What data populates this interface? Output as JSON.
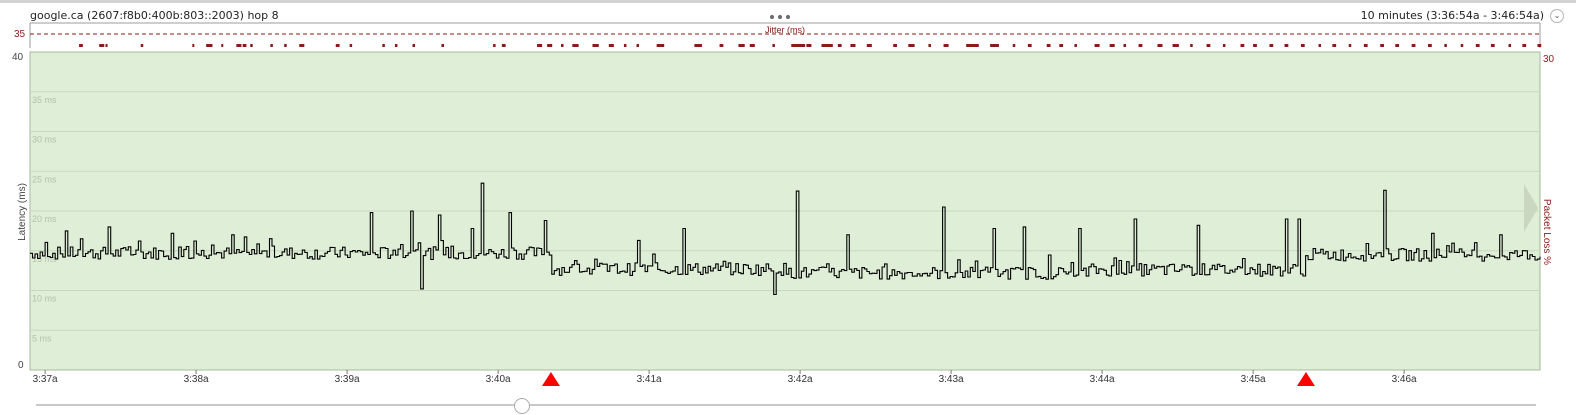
{
  "header": {
    "title": "google.ca (2607:f8b0:400b:803::2003) hop 8",
    "time_range": "10 minutes (3:36:54a - 3:46:54a)"
  },
  "colors": {
    "plot_bg": "#dfeed6",
    "jitter": "#8b1a1a",
    "loss_marker": "#ff0000",
    "latency_line": "#000000",
    "axis_text": "#555555"
  },
  "chart_data": [
    {
      "type": "bar",
      "title": "Jitter (ms)",
      "ymax_label": "35",
      "threshold_line": "dashed",
      "bar_intervals_min": [
        [
          3.9,
          4.2
        ],
        [
          5.5,
          5.9
        ],
        [
          6.0,
          6.15
        ],
        [
          8.8,
          9.0
        ],
        [
          12.9,
          13.05
        ],
        [
          14.0,
          14.5
        ],
        [
          15.2,
          15.3
        ],
        [
          16.4,
          16.8
        ],
        [
          16.9,
          17.2
        ],
        [
          17.5,
          17.7
        ],
        [
          19.1,
          19.3
        ],
        [
          20.2,
          20.4
        ],
        [
          21.4,
          21.8
        ],
        [
          24.3,
          24.6
        ],
        [
          25.4,
          25.6
        ],
        [
          28.0,
          28.2
        ],
        [
          29.0,
          29.2
        ],
        [
          30.4,
          30.6
        ],
        [
          32.7,
          32.9
        ],
        [
          36.8,
          37.0
        ],
        [
          37.5,
          37.8
        ],
        [
          40.3,
          40.7
        ],
        [
          41.1,
          41.5
        ],
        [
          42.2,
          42.4
        ],
        [
          43.1,
          43.6
        ],
        [
          44.7,
          45.2
        ],
        [
          46.0,
          46.4
        ],
        [
          47.2,
          47.4
        ],
        [
          48.2,
          48.4
        ],
        [
          49.8,
          50.4
        ],
        [
          52.8,
          53.4
        ],
        [
          54.8,
          55.1
        ],
        [
          56.3,
          56.8
        ],
        [
          57.2,
          57.6
        ],
        [
          59.0,
          59.2
        ],
        [
          60.5,
          61.6
        ],
        [
          61.7,
          62.1
        ],
        [
          62.9,
          63.8
        ],
        [
          64.2,
          64.5
        ],
        [
          65.2,
          65.6
        ],
        [
          66.5,
          66.9
        ],
        [
          68.6,
          68.9
        ],
        [
          69.8,
          70.3
        ],
        [
          71.4,
          71.6
        ],
        [
          72.6,
          73.0
        ],
        [
          74.4,
          75.4
        ],
        [
          76.3,
          77.0
        ],
        [
          78.1,
          78.3
        ],
        [
          79.3,
          79.6
        ],
        [
          80.8,
          81.1
        ],
        [
          81.8,
          82.1
        ],
        [
          83.0,
          83.2
        ],
        [
          84.6,
          85.0
        ],
        [
          85.8,
          86.2
        ],
        [
          86.9,
          87.1
        ],
        [
          88.1,
          88.4
        ],
        [
          89.6,
          90.0
        ],
        [
          90.8,
          91.3
        ],
        [
          92.2,
          92.4
        ],
        [
          93.5,
          93.8
        ],
        [
          94.8,
          95.0
        ],
        [
          96.2,
          96.5
        ],
        [
          97.2,
          97.5
        ],
        [
          98.5,
          98.8
        ],
        [
          99.7,
          100.0
        ],
        [
          101.0,
          101.3
        ],
        [
          102.4,
          102.6
        ],
        [
          103.5,
          103.8
        ],
        [
          104.8,
          105.0
        ],
        [
          106.0,
          106.3
        ],
        [
          107.3,
          107.6
        ],
        [
          108.5,
          108.8
        ],
        [
          109.8,
          110.1
        ],
        [
          111.1,
          111.4
        ],
        [
          112.4,
          112.6
        ],
        [
          113.7,
          113.9
        ],
        [
          114.9,
          115.2
        ],
        [
          116.1,
          116.4
        ],
        [
          117.5,
          117.7
        ],
        [
          118.6,
          118.9
        ],
        [
          119.8,
          120.1
        ]
      ]
    },
    {
      "type": "line",
      "xlabel": "",
      "ylabel": "Latency (ms)",
      "ylabel_right": "Packet Loss %",
      "ylim": [
        0,
        40
      ],
      "ylim_right_max": 30,
      "ytick_labels": [
        "40",
        "0"
      ],
      "ytick_right_labels": [
        "30"
      ],
      "gridline_labels": [
        "35 ms",
        "30 ms",
        "25 ms",
        "20 ms",
        "15 ms",
        "10 ms",
        "5 ms"
      ],
      "gridline_values": [
        35,
        30,
        25,
        20,
        15,
        10,
        5
      ],
      "x_tick_labels": [
        "3:37a",
        "3:38a",
        "3:39a",
        "3:40a",
        "3:41a",
        "3:42a",
        "3:43a",
        "3:44a",
        "3:45a",
        "3:46a"
      ],
      "x_tick_offsets_min": [
        0.1,
        1.1,
        2.1,
        3.1,
        4.1,
        5.1,
        6.1,
        7.1,
        8.1,
        9.1
      ],
      "x_range_min": [
        0,
        10
      ],
      "packet_loss_events_min": [
        3.45,
        8.45
      ],
      "grid": true,
      "series": [
        {
          "baseline_segments": [
            {
              "from_min": 0.0,
              "to_min": 3.45,
              "ms": 14.7
            },
            {
              "from_min": 3.45,
              "to_min": 5.0,
              "ms": 12.7
            },
            {
              "from_min": 5.0,
              "to_min": 7.0,
              "ms": 12.2
            },
            {
              "from_min": 7.0,
              "to_min": 8.45,
              "ms": 12.6
            },
            {
              "from_min": 8.45,
              "to_min": 10.0,
              "ms": 14.5
            }
          ],
          "spikes": [
            {
              "t_min": 0.23,
              "ms": 17.5
            },
            {
              "t_min": 0.52,
              "ms": 18.0
            },
            {
              "t_min": 0.93,
              "ms": 17.2
            },
            {
              "t_min": 1.33,
              "ms": 17.0
            },
            {
              "t_min": 2.25,
              "ms": 19.8
            },
            {
              "t_min": 2.52,
              "ms": 20.0
            },
            {
              "t_min": 2.71,
              "ms": 19.5
            },
            {
              "t_min": 2.92,
              "ms": 17.8
            },
            {
              "t_min": 2.99,
              "ms": 23.5
            },
            {
              "t_min": 3.17,
              "ms": 19.8
            },
            {
              "t_min": 3.41,
              "ms": 18.8
            },
            {
              "t_min": 4.03,
              "ms": 16.3
            },
            {
              "t_min": 4.33,
              "ms": 17.8
            },
            {
              "t_min": 5.08,
              "ms": 22.5
            },
            {
              "t_min": 5.41,
              "ms": 17.0
            },
            {
              "t_min": 6.05,
              "ms": 20.5
            },
            {
              "t_min": 6.37,
              "ms": 17.8
            },
            {
              "t_min": 6.57,
              "ms": 18.0
            },
            {
              "t_min": 6.95,
              "ms": 17.8
            },
            {
              "t_min": 7.32,
              "ms": 19.0
            },
            {
              "t_min": 7.73,
              "ms": 18.2
            },
            {
              "t_min": 8.32,
              "ms": 19.0
            },
            {
              "t_min": 8.4,
              "ms": 19.0
            },
            {
              "t_min": 8.96,
              "ms": 22.6
            },
            {
              "t_min": 9.28,
              "ms": 17.2
            },
            {
              "t_min": 9.73,
              "ms": 17.0
            }
          ],
          "dips": [
            {
              "t_min": 2.58,
              "ms": 10.2
            },
            {
              "t_min": 4.92,
              "ms": 9.5
            }
          ]
        }
      ]
    }
  ]
}
